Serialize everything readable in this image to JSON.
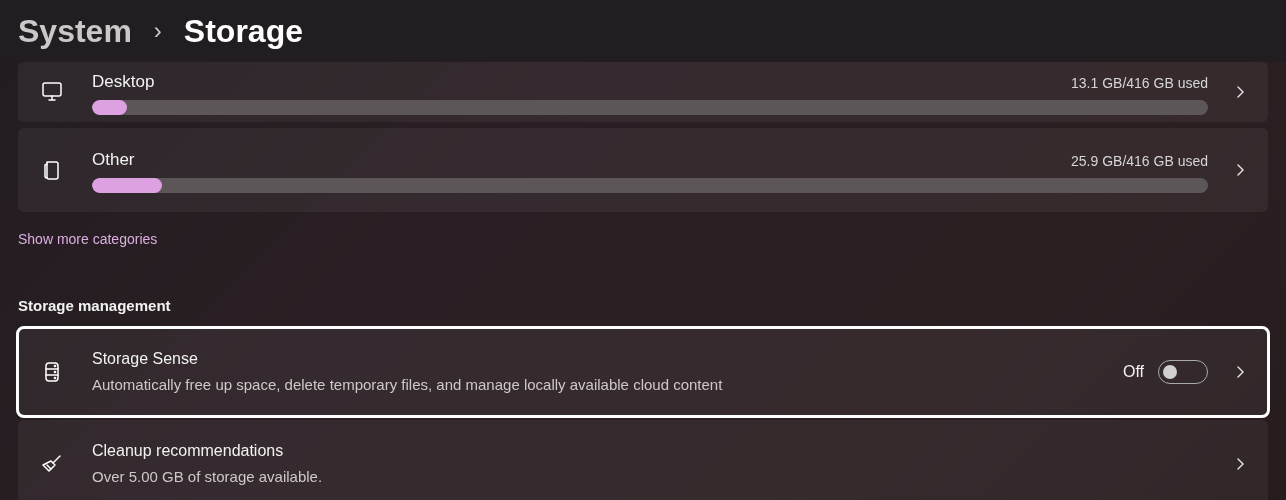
{
  "breadcrumb": {
    "parent": "System",
    "separator": "›",
    "current": "Storage"
  },
  "categories": [
    {
      "kind": "monitor",
      "name": "Desktop",
      "usage": "13.1 GB/416 GB used",
      "level": 0.031
    },
    {
      "kind": "files",
      "name": "Other",
      "usage": "25.9 GB/416 GB used",
      "level": 0.0625
    }
  ],
  "show_more_link": "Show more categories",
  "section_title": "Storage management",
  "management_items": [
    {
      "kind": "drive",
      "title": "Storage Sense",
      "description": "Automatically free up space, delete temporary files, and manage locally available cloud content",
      "focused": true,
      "toggle": {
        "label": "Off",
        "on": false
      }
    },
    {
      "kind": "broom",
      "title": "Cleanup recommendations",
      "description": "Over 5.00 GB of storage available.",
      "focused": false
    }
  ]
}
